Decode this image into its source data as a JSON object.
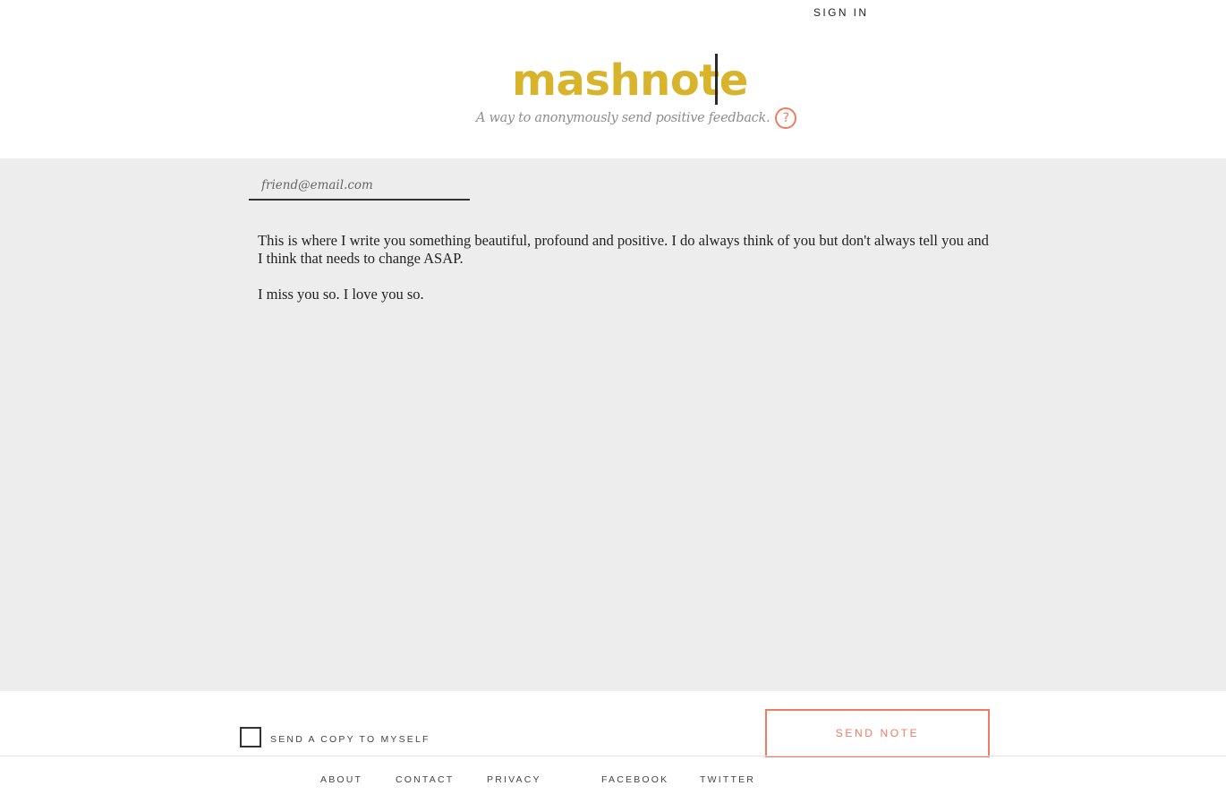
{
  "header": {
    "sign_in_label": "SIGN IN",
    "logo": "mashnote",
    "tagline": "A way to anonymously send positive feedback.",
    "help_symbol": "?"
  },
  "compose": {
    "recipient_placeholder": "friend@email.com",
    "message_paragraphs": [
      "This is where I write you something beautiful, profound and positive. I do always think of you but don't always tell you and I think that needs to change ASAP.",
      "I miss you so. I love you so."
    ]
  },
  "actions": {
    "copy_label": "SEND A COPY TO MYSELF",
    "copy_checked": false,
    "send_label": "SEND NOTE"
  },
  "footer": {
    "about": "ABOUT",
    "contact": "CONTACT",
    "privacy": "PRIVACY",
    "facebook": "FACEBOOK",
    "twitter": "TWITTER"
  },
  "colors": {
    "brand": "#d8b32c",
    "accent": "#f07a62",
    "compose_bg": "#ededed"
  }
}
